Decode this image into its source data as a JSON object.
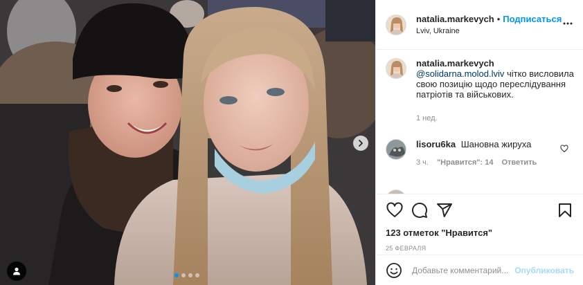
{
  "post": {
    "username": "natalia.markevych",
    "separator": "•",
    "follow_label": "Подписаться",
    "location": "Lviv, Ukraine",
    "more_icon": "more-horizontal-icon"
  },
  "caption": {
    "username": "natalia.markevych",
    "mention": "@solidarna.molod.lviv",
    "text": " чітко висловила свою позицію щодо переслідування патріотів та військових.",
    "time": "1 нед."
  },
  "comments": [
    {
      "username": "lisoru6ka",
      "text": "Шановна жируха",
      "time": "3 ч.",
      "likes_label": "\"Нравится\": 14",
      "reply_label": "Ответить"
    }
  ],
  "actions": {
    "like_icon": "heart-icon",
    "comment_icon": "comment-icon",
    "share_icon": "paper-plane-icon",
    "save_icon": "bookmark-icon",
    "likes_text": "123 отметок \"Нравится\"",
    "date_text": "25 ФЕВРАЛЯ"
  },
  "add_comment": {
    "placeholder": "Добавьте комментарий...",
    "publish_label": "Опубликовать"
  },
  "carousel": {
    "total": 4,
    "active": 1
  },
  "colors": {
    "accent": "#0095f6",
    "text": "#262626",
    "muted": "#8e8e8e",
    "border": "#efefef"
  }
}
